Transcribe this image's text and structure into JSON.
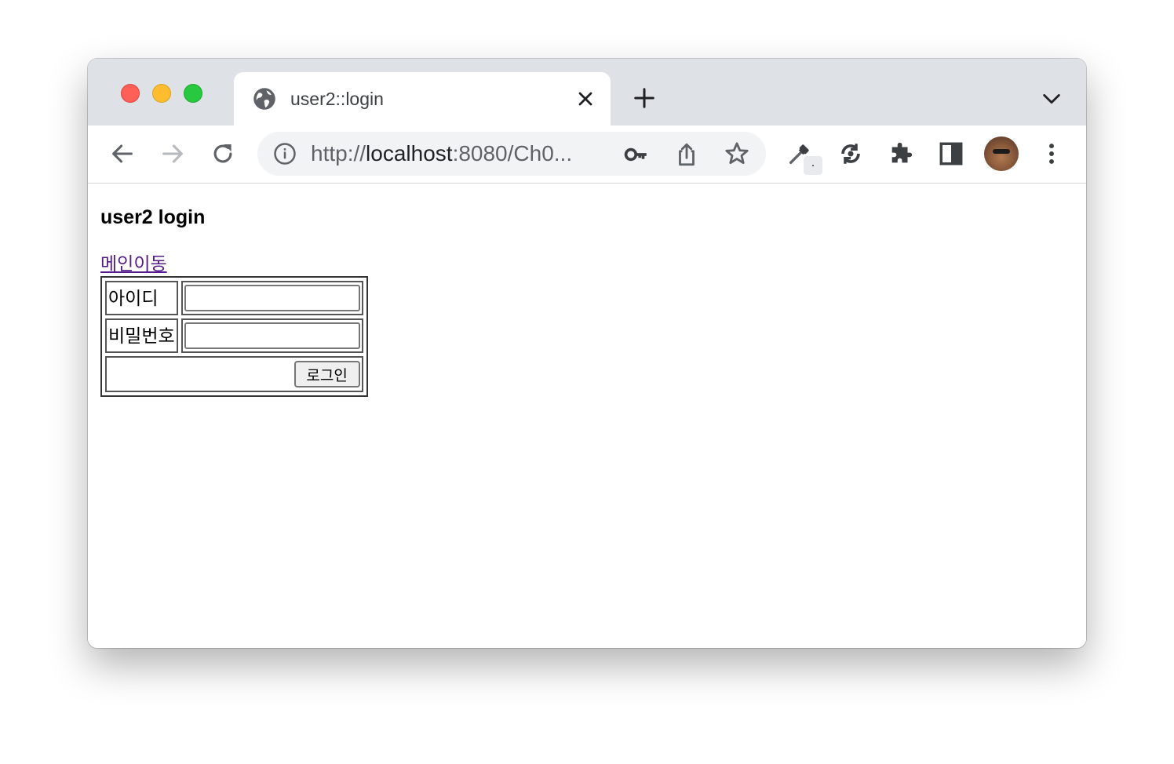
{
  "browser": {
    "tab": {
      "title": "user2::login",
      "icon": "globe-icon"
    },
    "address_bar": {
      "scheme": "http://",
      "host": "localhost",
      "rest": ":8080/Ch0...",
      "icon": "info-icon"
    },
    "toolbar_icons": [
      "back-arrow-icon",
      "forward-arrow-icon",
      "reload-icon",
      "key-icon",
      "share-icon",
      "star-icon",
      "eyedropper-icon",
      "sync-icon",
      "puzzle-icon",
      "side-panel-icon",
      "avatar",
      "kebab-menu-icon"
    ],
    "eyedropper_badge": "."
  },
  "page": {
    "title": "user2 login",
    "main_link": "메인이동",
    "form": {
      "id_label": "아이디",
      "id_value": "",
      "password_label": "비밀번호",
      "password_value": "",
      "submit_label": "로그인"
    }
  },
  "colors": {
    "titlebar": "#dee1e6",
    "omnibox": "#f1f3f4",
    "link_visited": "#551a8b",
    "traffic_red": "#fe5f57",
    "traffic_yellow": "#febc2e",
    "traffic_green": "#28c840"
  }
}
